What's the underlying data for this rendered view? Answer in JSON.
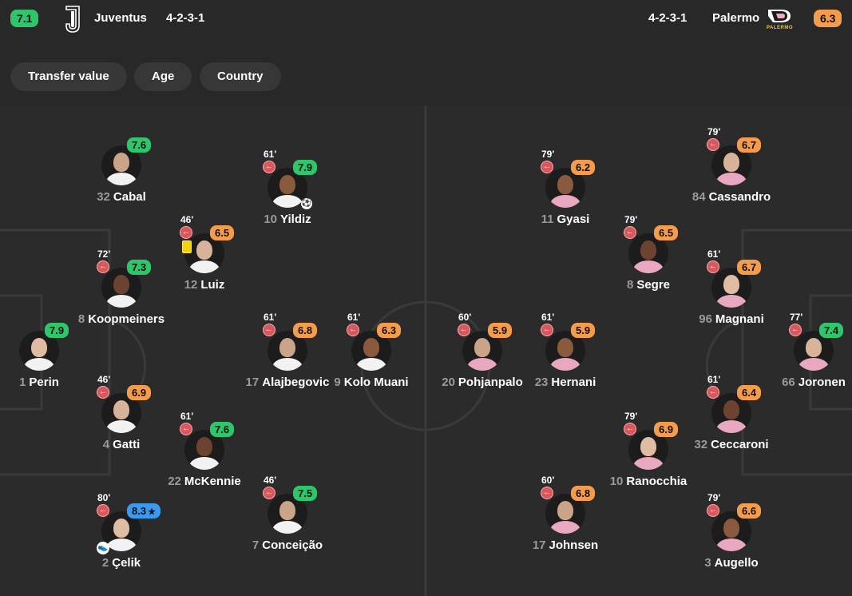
{
  "header": {
    "home": {
      "rating": "7.1",
      "name": "Juventus",
      "formation": "4-2-3-1",
      "logo": "juventus-logo"
    },
    "away": {
      "rating": "6.3",
      "name": "Palermo",
      "formation": "4-2-3-1",
      "logo": "palermo-logo",
      "logo_text": "PALERMO"
    }
  },
  "filters": [
    "Transfer value",
    "Age",
    "Country"
  ],
  "colors": {
    "green": "#2fc56b",
    "orange": "#f59b4c",
    "blue": "#3a9af2",
    "sub": "#d7585d",
    "card": "#f2d10f"
  },
  "players": [
    {
      "num": "32",
      "name": "Cabal",
      "rating": "7.6",
      "color": "green",
      "minute": null,
      "sub": false
    },
    {
      "num": "10",
      "name": "Yildiz",
      "rating": "7.9",
      "color": "green",
      "minute": "61'",
      "sub": true,
      "goal": true
    },
    {
      "num": "12",
      "name": "Luiz",
      "rating": "6.5",
      "color": "orange",
      "minute": "46'",
      "sub": true,
      "card": true
    },
    {
      "num": "8",
      "name": "Koopmeiners",
      "rating": "7.3",
      "color": "green",
      "minute": "72'",
      "sub": true
    },
    {
      "num": "1",
      "name": "Perin",
      "rating": "7.9",
      "color": "green",
      "minute": null,
      "sub": false
    },
    {
      "num": "17",
      "name": "Alajbegovic",
      "rating": "6.8",
      "color": "orange",
      "minute": "61'",
      "sub": true
    },
    {
      "num": "9",
      "name": "Kolo Muani",
      "rating": "6.3",
      "color": "orange",
      "minute": "61'",
      "sub": true
    },
    {
      "num": "4",
      "name": "Gatti",
      "rating": "6.9",
      "color": "orange",
      "minute": "46'",
      "sub": true
    },
    {
      "num": "22",
      "name": "McKennie",
      "rating": "7.6",
      "color": "green",
      "minute": "61'",
      "sub": true
    },
    {
      "num": "2",
      "name": "Çelik",
      "rating": "8.3",
      "color": "blue",
      "minute": "80'",
      "sub": true,
      "star": true,
      "assist": true
    },
    {
      "num": "7",
      "name": "Conceição",
      "rating": "7.5",
      "color": "green",
      "minute": "46'",
      "sub": true
    },
    {
      "num": "11",
      "name": "Gyasi",
      "rating": "6.2",
      "color": "orange",
      "minute": "79'",
      "sub": true
    },
    {
      "num": "84",
      "name": "Cassandro",
      "rating": "6.7",
      "color": "orange",
      "minute": "79'",
      "sub": true
    },
    {
      "num": "8",
      "name": "Segre",
      "rating": "6.5",
      "color": "orange",
      "minute": "79'",
      "sub": true
    },
    {
      "num": "96",
      "name": "Magnani",
      "rating": "6.7",
      "color": "orange",
      "minute": "61'",
      "sub": true
    },
    {
      "num": "20",
      "name": "Pohjanpalo",
      "rating": "5.9",
      "color": "orange",
      "minute": "60'",
      "sub": true
    },
    {
      "num": "23",
      "name": "Hernani",
      "rating": "5.9",
      "color": "orange",
      "minute": "61'",
      "sub": true
    },
    {
      "num": "66",
      "name": "Joronen",
      "rating": "7.4",
      "color": "green",
      "minute": "77'",
      "sub": true
    },
    {
      "num": "32",
      "name": "Ceccaroni",
      "rating": "6.4",
      "color": "orange",
      "minute": "61'",
      "sub": true
    },
    {
      "num": "10",
      "name": "Ranocchia",
      "rating": "6.9",
      "color": "orange",
      "minute": "79'",
      "sub": true
    },
    {
      "num": "17",
      "name": "Johnsen",
      "rating": "6.8",
      "color": "orange",
      "minute": "60'",
      "sub": true
    },
    {
      "num": "3",
      "name": "Augello",
      "rating": "6.6",
      "color": "orange",
      "minute": "79'",
      "sub": true
    }
  ]
}
